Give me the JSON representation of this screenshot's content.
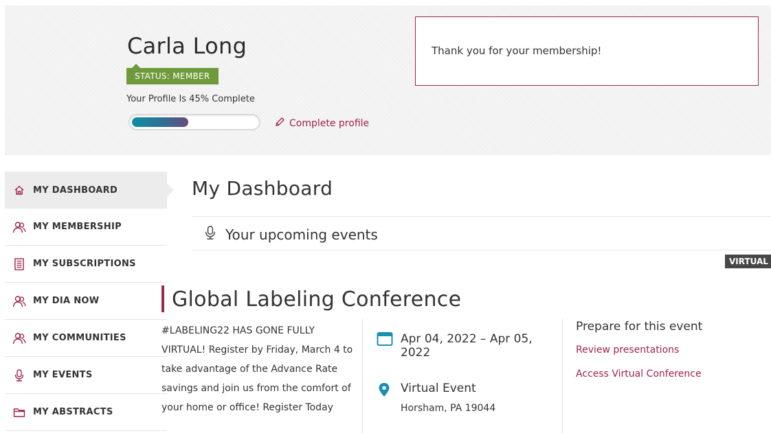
{
  "profile": {
    "name": "Carla Long",
    "status": "STATUS: MEMBER",
    "completion_text": "Your Profile Is 45% Complete",
    "completion_percent": 45,
    "complete_link": "Complete profile",
    "thank_you": "Thank you for your membership!"
  },
  "colors": {
    "accent": "#a0224f",
    "status_green": "#6f9a3c",
    "progress_start": "#0f8fa8",
    "progress_end": "#6a4a7d",
    "info_teal": "#1a8fb0"
  },
  "sidebar": {
    "items": [
      {
        "label": "MY DASHBOARD",
        "icon": "home-icon",
        "active": true
      },
      {
        "label": "MY MEMBERSHIP",
        "icon": "people-icon"
      },
      {
        "label": "MY SUBSCRIPTIONS",
        "icon": "document-icon"
      },
      {
        "label": "MY DIA NOW",
        "icon": "people-icon"
      },
      {
        "label": "MY COMMUNITIES",
        "icon": "people-icon"
      },
      {
        "label": "MY EVENTS",
        "icon": "microphone-icon"
      },
      {
        "label": "MY ABSTRACTS",
        "icon": "folder-icon"
      }
    ]
  },
  "main": {
    "title": "My Dashboard",
    "section_title": "Your upcoming events",
    "event": {
      "tag": "VIRTUAL",
      "title": "Global Labeling Conference",
      "description": "#LABELING22 HAS GONE FULLY VIRTUAL! Register by Friday, March 4 to take advantage of the Advance Rate savings and join us from the comfort of your home or office! Register Today",
      "date": "Apr 04, 2022 – Apr 05, 2022",
      "venue": "Virtual Event",
      "address": "Horsham, PA 19044",
      "prepare_heading": "Prepare for this event",
      "links": [
        "Review presentations",
        "Access Virtual Conference"
      ]
    }
  }
}
